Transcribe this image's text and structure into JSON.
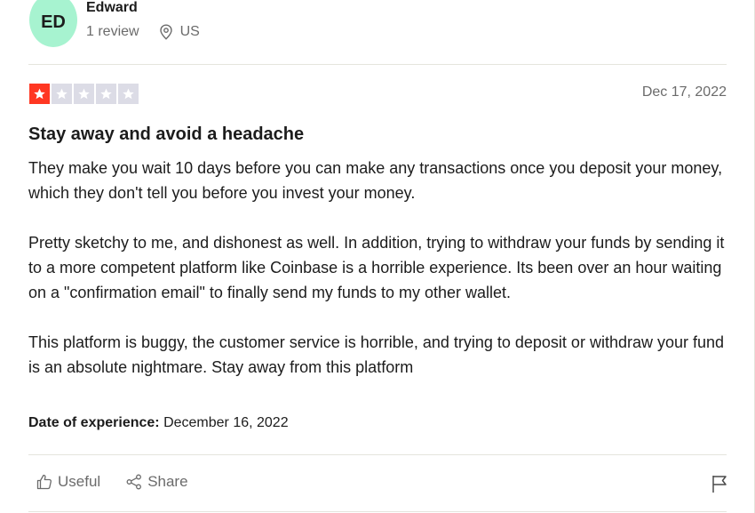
{
  "reviewer": {
    "initials": "ED",
    "name": "Edward",
    "review_count": "1 review",
    "country": "US",
    "avatar_color": "#a7f3d0"
  },
  "review": {
    "rating": 1,
    "max_rating": 5,
    "star_filled_color": "#ff3722",
    "star_empty_color": "#dcdce6",
    "date": "Dec 17, 2022",
    "title": "Stay away and avoid a headache",
    "paragraphs": [
      "They make you wait 10 days before you can make any transactions once you deposit your money, which they don't tell you before you invest your money.",
      "Pretty sketchy to me, and dishonest as well. In addition, trying to withdraw your funds by sending it to a more competent platform like Coinbase is a horrible experience. Its been over an hour waiting on a \"confirmation email\" to finally send my funds to my other wallet.",
      "This platform is buggy, the customer service is horrible, and trying to deposit or withdraw your fund is an absolute nightmare. Stay away from this platform"
    ],
    "experience_label": "Date of experience:",
    "experience_date": "December 16, 2022"
  },
  "actions": {
    "useful_label": "Useful",
    "share_label": "Share",
    "useful_icon": "thumbs-up-icon",
    "share_icon": "share-icon",
    "flag_icon": "flag-icon"
  }
}
